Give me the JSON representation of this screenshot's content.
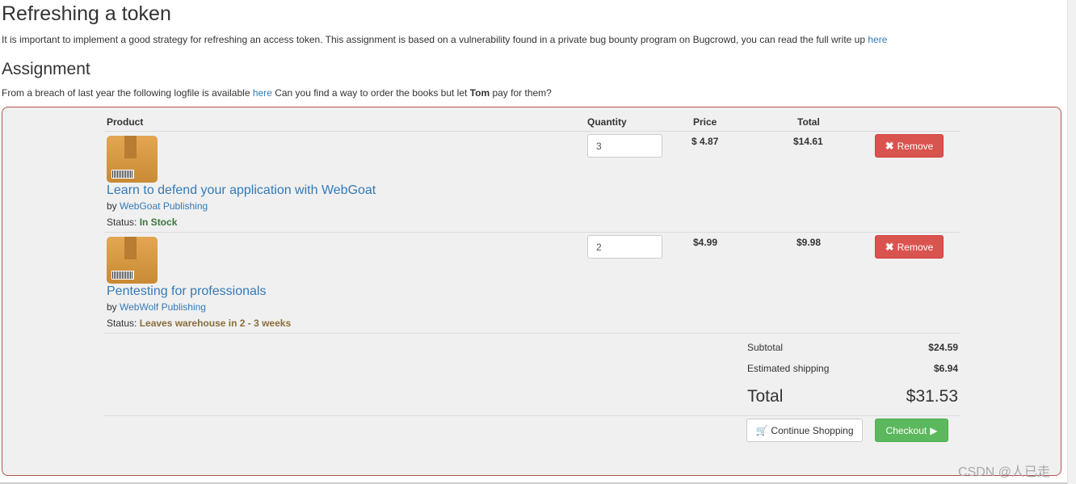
{
  "page": {
    "title": "Refreshing a token",
    "intro": "It is important to implement a good strategy for refreshing an access token. This assignment is based on a vulnerability found in a private bug bounty program on Bugcrowd, you can read the full write up ",
    "intro_link": "here",
    "assignment_heading": "Assignment",
    "assignment_text_1": "From a breach of last year the following logfile is available ",
    "assignment_link": "here",
    "assignment_text_2": " Can you find a way to order the books but let ",
    "assignment_bold": "Tom",
    "assignment_text_3": " pay for them?"
  },
  "cart": {
    "headers": {
      "product": "Product",
      "quantity": "Quantity",
      "price": "Price",
      "total": "Total"
    },
    "items": [
      {
        "title": "Learn to defend your application with WebGoat",
        "by": "by ",
        "publisher": "WebGoat Publishing",
        "status_label": "Status: ",
        "status": "In Stock",
        "quantity": "3",
        "price": "$ 4.87",
        "total": "$14.61",
        "remove_label": "Remove"
      },
      {
        "title": "Pentesting for professionals",
        "by": "by ",
        "publisher": "WebWolf Publishing",
        "status_label": "Status: ",
        "status": "Leaves warehouse in 2 - 3 weeks",
        "quantity": "2",
        "price": "$4.99",
        "total": "$9.98",
        "remove_label": "Remove"
      }
    ],
    "subtotal_label": "Subtotal",
    "subtotal": "$24.59",
    "shipping_label": "Estimated shipping",
    "shipping": "$6.94",
    "grand_label": "Total",
    "grand_total": "$31.53",
    "continue_label": "Continue Shopping",
    "checkout_label": "Checkout"
  },
  "watermark": "CSDN @人已走",
  "colors": {
    "accent_link": "#337ab7",
    "danger": "#d9534f",
    "success": "#5cb85c",
    "box_border": "#b2514c"
  },
  "icons": {
    "remove": "times-icon",
    "cart": "shopping-cart-icon",
    "checkout": "play-icon",
    "product": "package-box-icon"
  }
}
